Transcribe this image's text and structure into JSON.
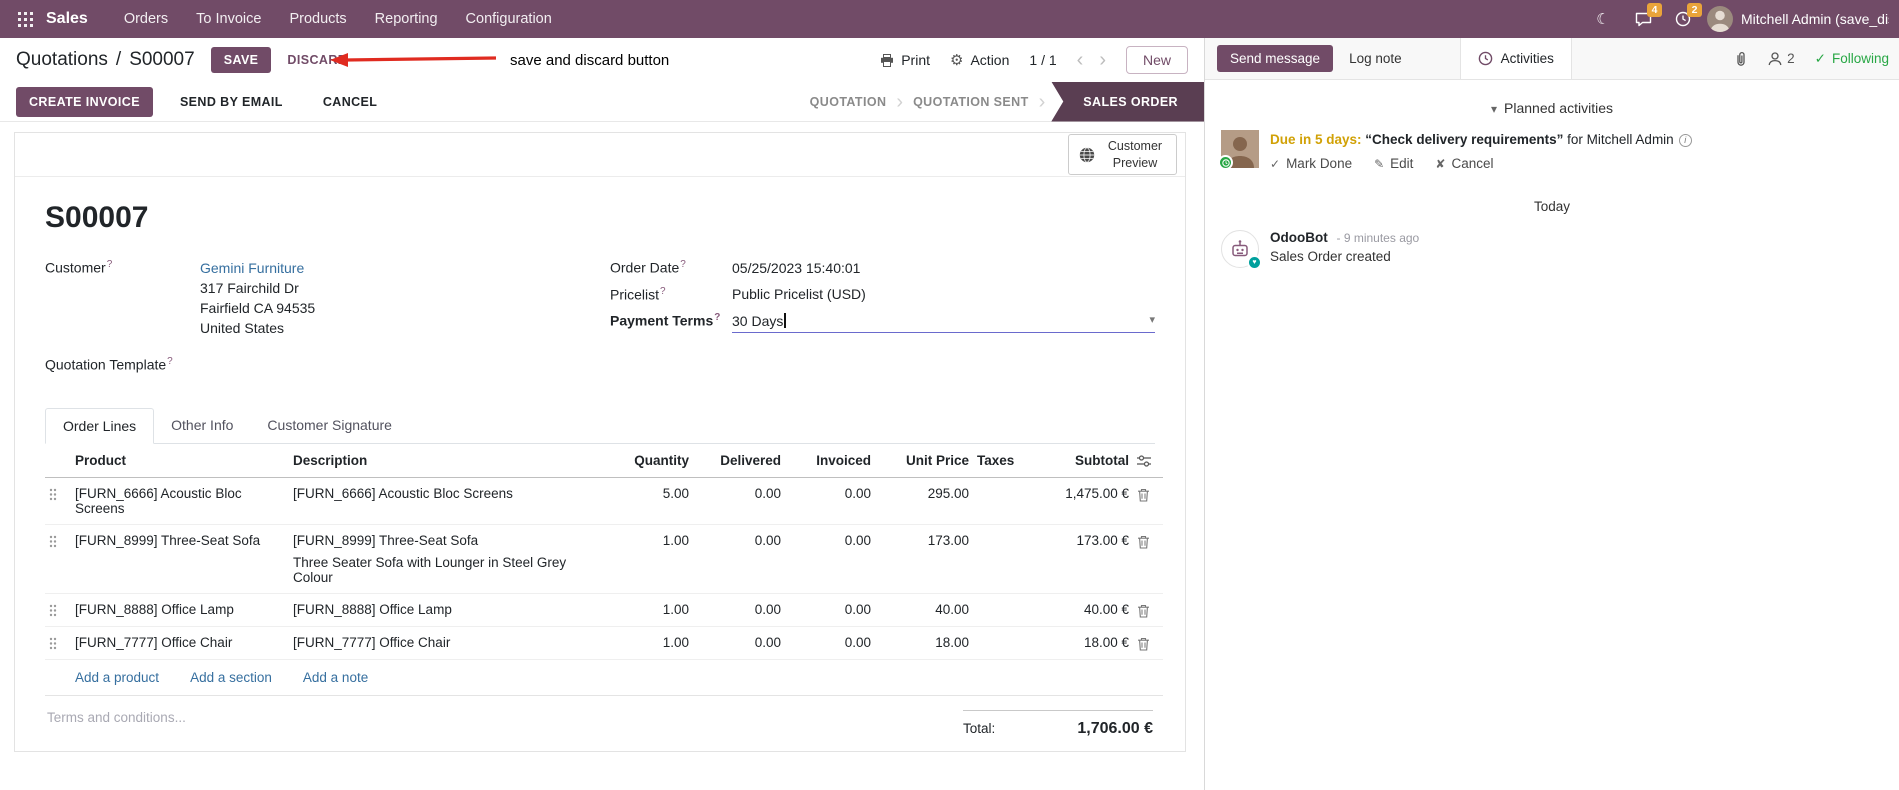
{
  "colors": {
    "primary": "#714B67",
    "status_active_bg": "#5a3e52",
    "link": "#366f9f",
    "edited_value_blue": "#3a6fd0",
    "following_green": "#28a745",
    "activity_due": "#d1a106",
    "annotation_red": "#e02b20",
    "systray_badge": "#eaa43a"
  },
  "icons": {
    "moon": "☾",
    "gear": "⚙",
    "chevron_left": "‹",
    "chevron_right": "›",
    "step_chevron": "›",
    "caret_down": "▾",
    "collapse_caret": "▾",
    "check": "✓",
    "pencil": "✎",
    "cross": "✘",
    "heart": "♥",
    "info": "i"
  },
  "navbar": {
    "app_name": "Sales",
    "menus": [
      "Orders",
      "To Invoice",
      "Products",
      "Reporting",
      "Configuration"
    ],
    "messages_badge": "4",
    "activities_badge": "2",
    "user_name": "Mitchell Admin (save_discar"
  },
  "control_panel": {
    "breadcrumb_parent": "Quotations",
    "breadcrumb_separator": "/",
    "current_record": "S00007",
    "save": "SAVE",
    "discard": "DISCARD",
    "annotation": "save and discard button",
    "print": "Print",
    "action": "Action",
    "pager": "1 / 1",
    "new": "New"
  },
  "statusbar": {
    "create_invoice": "CREATE INVOICE",
    "send_by_email": "SEND BY EMAIL",
    "cancel": "CANCEL",
    "steps": [
      "QUOTATION",
      "QUOTATION SENT",
      "SALES ORDER"
    ],
    "active_step": "SALES ORDER"
  },
  "form": {
    "preview_button": "Customer Preview",
    "title": "S00007",
    "help_marker": "?",
    "customer_label": "Customer",
    "customer_name": "Gemini Furniture",
    "address_line1": "317 Fairchild Dr",
    "address_line2": "Fairfield CA 94535",
    "address_line3": "United States",
    "quotation_template_label": "Quotation Template",
    "order_date_label": "Order Date",
    "order_date": "05/25/2023 15:40:01",
    "pricelist_label": "Pricelist",
    "pricelist": "Public Pricelist (USD)",
    "payment_terms_label": "Payment Terms",
    "payment_terms": "30 Days",
    "tabs": [
      "Order Lines",
      "Other Info",
      "Customer Signature"
    ],
    "active_tab": "Order Lines"
  },
  "order_lines": {
    "columns": [
      "Product",
      "Description",
      "Quantity",
      "Delivered",
      "Invoiced",
      "Unit Price",
      "Taxes",
      "Subtotal"
    ],
    "rows": [
      {
        "product": "[FURN_6666] Acoustic Bloc Screens",
        "description": "[FURN_6666] Acoustic Bloc Screens",
        "description2": "",
        "quantity": "5.00",
        "delivered": "0.00",
        "invoiced": "0.00",
        "unit_price": "295.00",
        "taxes": "",
        "subtotal": "1,475.00 €"
      },
      {
        "product": "[FURN_8999] Three-Seat Sofa",
        "description": "[FURN_8999] Three-Seat Sofa",
        "description2": "Three Seater Sofa with Lounger in Steel Grey Colour",
        "quantity": "1.00",
        "delivered": "0.00",
        "invoiced": "0.00",
        "unit_price": "173.00",
        "taxes": "",
        "subtotal": "173.00 €"
      },
      {
        "product": "[FURN_8888] Office Lamp",
        "description": "[FURN_8888] Office Lamp",
        "description2": "",
        "quantity": "1.00",
        "delivered": "0.00",
        "invoiced": "0.00",
        "unit_price": "40.00",
        "taxes": "",
        "subtotal": "40.00 €"
      },
      {
        "product": "[FURN_7777] Office Chair",
        "description": "[FURN_7777] Office Chair",
        "description2": "",
        "quantity": "1.00",
        "delivered": "0.00",
        "invoiced": "0.00",
        "unit_price": "18.00",
        "taxes": "",
        "subtotal": "18.00 €"
      }
    ],
    "add_product": "Add a product",
    "add_section": "Add a section",
    "add_note": "Add a note",
    "terms_placeholder": "Terms and conditions...",
    "total_label": "Total:",
    "total_value": "1,706.00 €"
  },
  "chatter": {
    "send_message": "Send message",
    "log_note": "Log note",
    "activities": "Activities",
    "followers_count": "2",
    "following": "Following",
    "planned_activities": "Planned activities",
    "activity": {
      "due": "Due in 5 days:",
      "summary": "“Check delivery requirements”",
      "assignee": "for Mitchell Admin",
      "mark_done": "Mark Done",
      "edit": "Edit",
      "cancel": "Cancel"
    },
    "day_divider": "Today",
    "message": {
      "author": "OdooBot",
      "time": "- 9 minutes ago",
      "body": "Sales Order created"
    }
  }
}
